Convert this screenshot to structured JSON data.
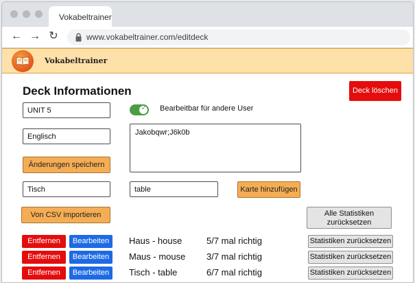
{
  "browser": {
    "tab_title": "Vokabeltrainer",
    "url": "www.vokabeltrainer.com/editdeck"
  },
  "header": {
    "app_name": "Vokabeltrainer"
  },
  "page": {
    "title": "Deck Informationen",
    "delete_deck_label": "Deck löschen"
  },
  "form": {
    "deck_name": "UNIT 5",
    "language": "Englisch",
    "editable_toggle_label": "Bearbeitbar für andere User",
    "editable_toggle_on": true,
    "users_text": "Jakobqwr;J6k0b",
    "save_label": "Änderungen speichern",
    "new_word": "Tisch",
    "new_translation": "table",
    "add_card_label": "Karte hinzufügen",
    "import_csv_label": "Von CSV importieren",
    "reset_all_stats_label": "Alle Statistiken zurücksetzen"
  },
  "cards": [
    {
      "term": "Haus - house",
      "stats": "5/7 mal richtig",
      "remove_label": "Entfernen",
      "edit_label": "Bearbeiten",
      "reset_label": "Statistiken zurücksetzen"
    },
    {
      "term": "Maus - mouse",
      "stats": "3/7 mal richtig",
      "remove_label": "Entfernen",
      "edit_label": "Bearbeiten",
      "reset_label": "Statistiken zurücksetzen"
    },
    {
      "term": "Tisch - table",
      "stats": "6/7 mal richtig",
      "remove_label": "Entfernen",
      "edit_label": "Bearbeiten",
      "reset_label": "Statistiken zurücksetzen"
    }
  ],
  "colors": {
    "header_bg": "#fde1a9",
    "danger": "#e40d0d",
    "primary": "#1d6ae5",
    "accent": "#f5ad54",
    "toggle_on": "#4c9c44"
  }
}
